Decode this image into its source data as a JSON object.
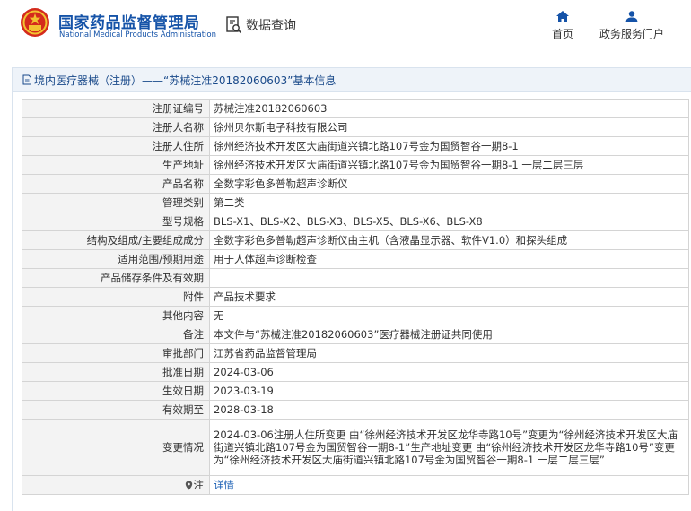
{
  "header": {
    "brand_cn": "国家药品监督管理局",
    "brand_en": "National Medical Products Administration",
    "query_label": "数据查询",
    "nav_home": "首页",
    "nav_portal": "政务服务门户"
  },
  "panel": {
    "title": "境内医疗器械（注册）——“苏械注准20182060603”基本信息"
  },
  "rows": [
    {
      "label": "注册证编号",
      "value": "苏械注准20182060603"
    },
    {
      "label": "注册人名称",
      "value": "徐州贝尔斯电子科技有限公司"
    },
    {
      "label": "注册人住所",
      "value": "徐州经济技术开发区大庙街道兴镇北路107号金为国贸智谷一期8-1"
    },
    {
      "label": "生产地址",
      "value": "徐州经济技术开发区大庙街道兴镇北路107号金为国贸智谷一期8-1 一层二层三层"
    },
    {
      "label": "产品名称",
      "value": "全数字彩色多普勒超声诊断仪"
    },
    {
      "label": "管理类别",
      "value": "第二类"
    },
    {
      "label": "型号规格",
      "value": "BLS-X1、BLS-X2、BLS-X3、BLS-X5、BLS-X6、BLS-X8"
    },
    {
      "label": "结构及组成/主要组成成分",
      "value": "全数字彩色多普勒超声诊断仪由主机（含液晶显示器、软件V1.0）和探头组成"
    },
    {
      "label": "适用范围/预期用途",
      "value": "用于人体超声诊断检查"
    },
    {
      "label": "产品储存条件及有效期",
      "value": ""
    },
    {
      "label": "附件",
      "value": "产品技术要求"
    },
    {
      "label": "其他内容",
      "value": "无"
    },
    {
      "label": "备注",
      "value": "本文件与“苏械注准20182060603”医疗器械注册证共同使用"
    },
    {
      "label": "审批部门",
      "value": "江苏省药品监督管理局"
    },
    {
      "label": "批准日期",
      "value": "2024-03-06"
    },
    {
      "label": "生效日期",
      "value": "2023-03-19"
    },
    {
      "label": "有效期至",
      "value": "2028-03-18"
    },
    {
      "label": "变更情况",
      "value": "2024-03-06注册人住所变更 由“徐州经济技术开发区龙华寺路10号”变更为“徐州经济技术开发区大庙街道兴镇北路107号金为国贸智谷一期8-1”生产地址变更 由“徐州经济技术开发区龙华寺路10号”变更为“徐州经济技术开发区大庙街道兴镇北路107号金为国贸智谷一期8-1 一层二层三层”"
    }
  ],
  "note_row": {
    "label": "注",
    "link_text": "详情"
  },
  "colors": {
    "brand": "#1553a8",
    "link": "#1a5fb4",
    "label_bg": "#f3f3f3",
    "emblem_red": "#d42a1c",
    "emblem_gold": "#f2c230"
  },
  "icons": {
    "emblem": "national-emblem-icon",
    "query": "document-search-icon",
    "home": "home-icon",
    "user": "user-icon",
    "doc": "document-icon",
    "note": "map-pin-icon"
  }
}
